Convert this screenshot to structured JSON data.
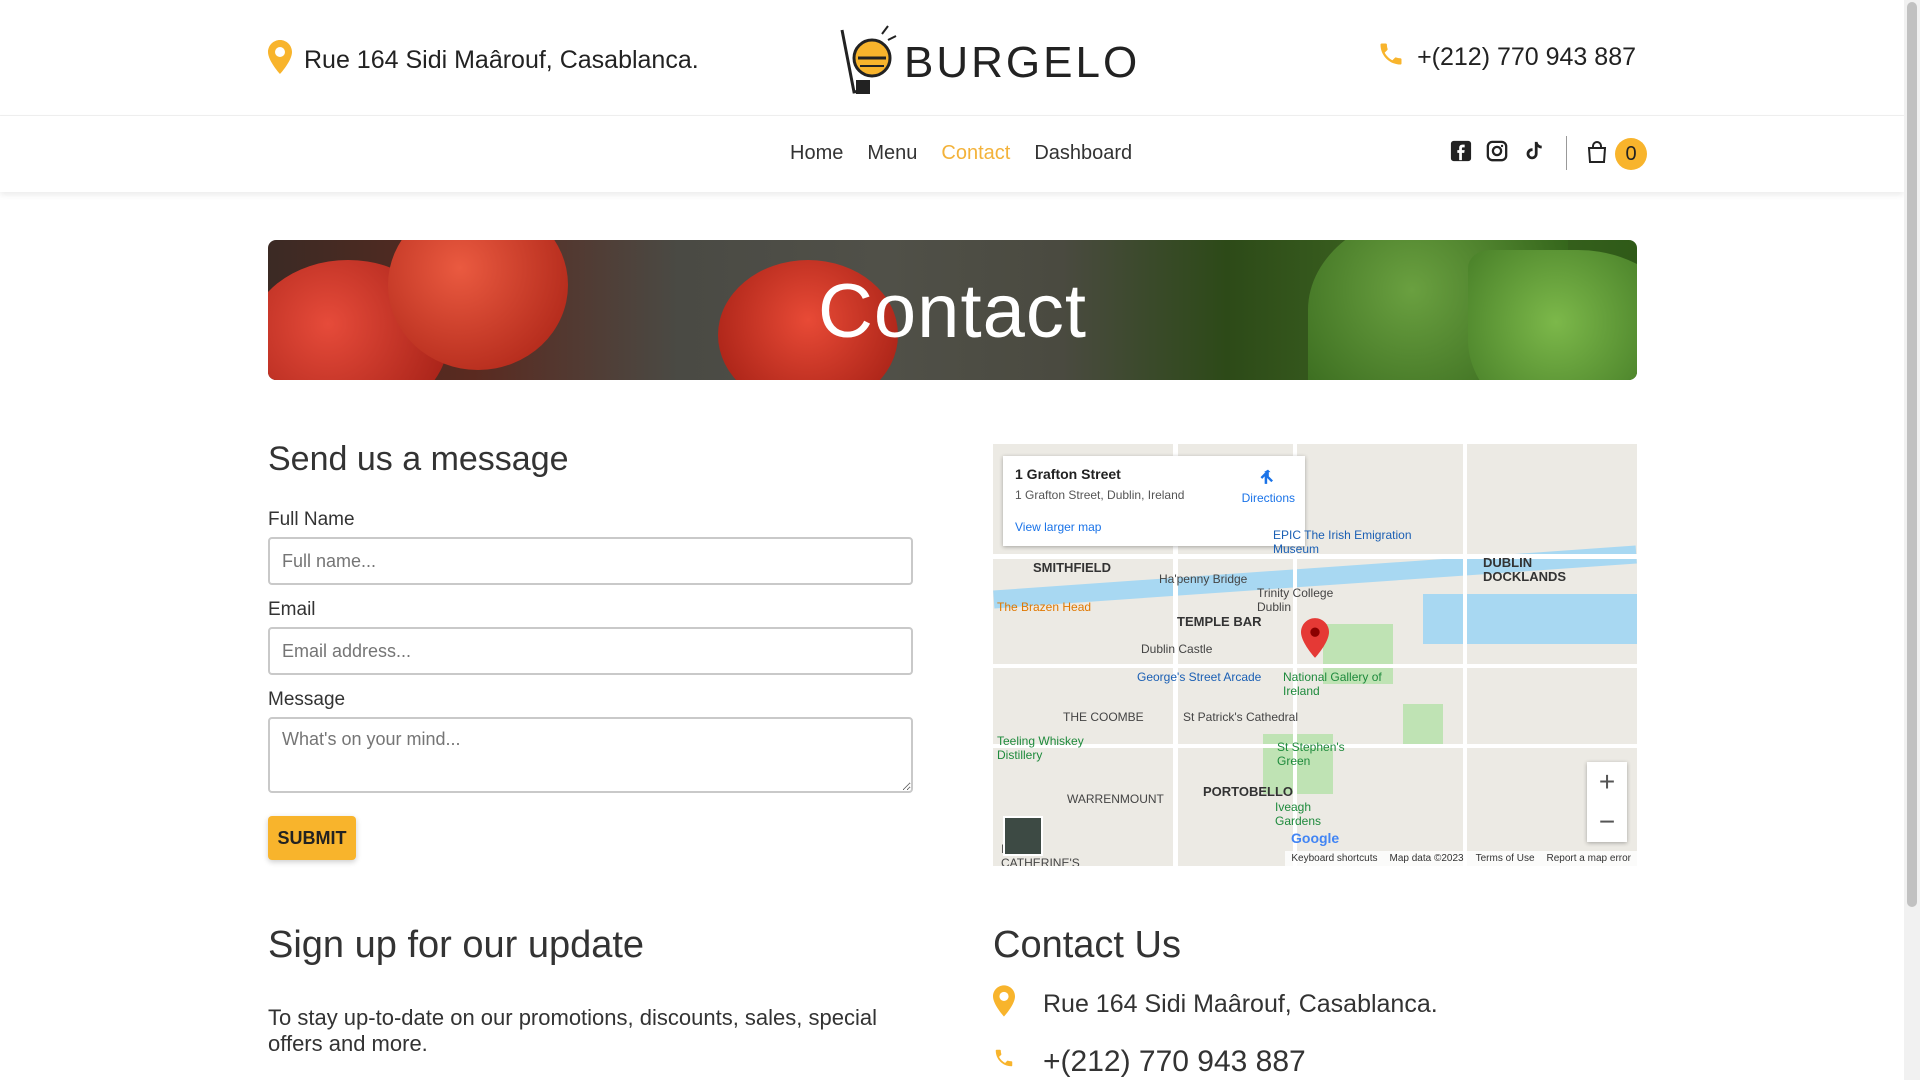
{
  "header": {
    "address": "Rue 164 Sidi Maârouf, Casablanca.",
    "phone": "+(212) 770 943 887",
    "logo_text": "BURGELO"
  },
  "nav": {
    "items": [
      {
        "label": "Home",
        "active": false
      },
      {
        "label": "Menu",
        "active": false
      },
      {
        "label": "Contact",
        "active": true
      },
      {
        "label": "Dashboard",
        "active": false
      }
    ],
    "cart_count": "0"
  },
  "hero": {
    "title": "Contact"
  },
  "form": {
    "title": "Send us a message",
    "full_name_label": "Full Name",
    "full_name_placeholder": "Full name...",
    "email_label": "Email",
    "email_placeholder": "Email address...",
    "message_label": "Message",
    "message_placeholder": "What's on your mind...",
    "submit_label": "SUBMIT"
  },
  "map": {
    "place_title": "1 Grafton Street",
    "place_address": "1 Grafton Street, Dublin, Ireland",
    "directions": "Directions",
    "view_larger": "View larger map",
    "labels": {
      "smithfield": "SMITHFIELD",
      "temple_bar": "TEMPLE BAR",
      "the_coombe": "THE COOMBE",
      "portobello": "PORTOBELLO",
      "warrenmount": "WARRENMOUNT",
      "docklands": "DUBLIN DOCKLANDS",
      "brazen_head": "The Brazen Head",
      "hapenny": "Ha'penny Bridge",
      "epic": "EPIC The Irish Emigration Museum",
      "trinity": "Trinity College Dublin",
      "dublin_castle": "Dublin Castle",
      "georges": "George's Street Arcade",
      "national_gallery": "National Gallery of Ireland",
      "patricks": "St Patrick's Cathedral",
      "teeling": "Teeling Whiskey Distillery",
      "stephens": "St Stephen's Green",
      "iveagh": "Iveagh Gardens",
      "catherines": "INT CATHERINE'S"
    },
    "footer": [
      "Keyboard shortcuts",
      "Map data ©2023",
      "Terms of Use",
      "Report a map error"
    ],
    "google": "Google",
    "zoom_in": "+",
    "zoom_out": "−"
  },
  "signup": {
    "title": "Sign up for our update",
    "text": "To stay up-to-date on our promotions, discounts, sales, special offers and more."
  },
  "contact_us": {
    "title": "Contact Us",
    "address": "Rue 164 Sidi Maârouf, Casablanca.",
    "phone": "+(212) 770 943 887"
  },
  "colors": {
    "accent": "#f8b42c",
    "active_nav": "#f3b23a"
  },
  "icons": [
    "location-pin-icon",
    "phone-icon",
    "facebook-icon",
    "instagram-icon",
    "tiktok-icon",
    "shopping-bag-icon"
  ]
}
